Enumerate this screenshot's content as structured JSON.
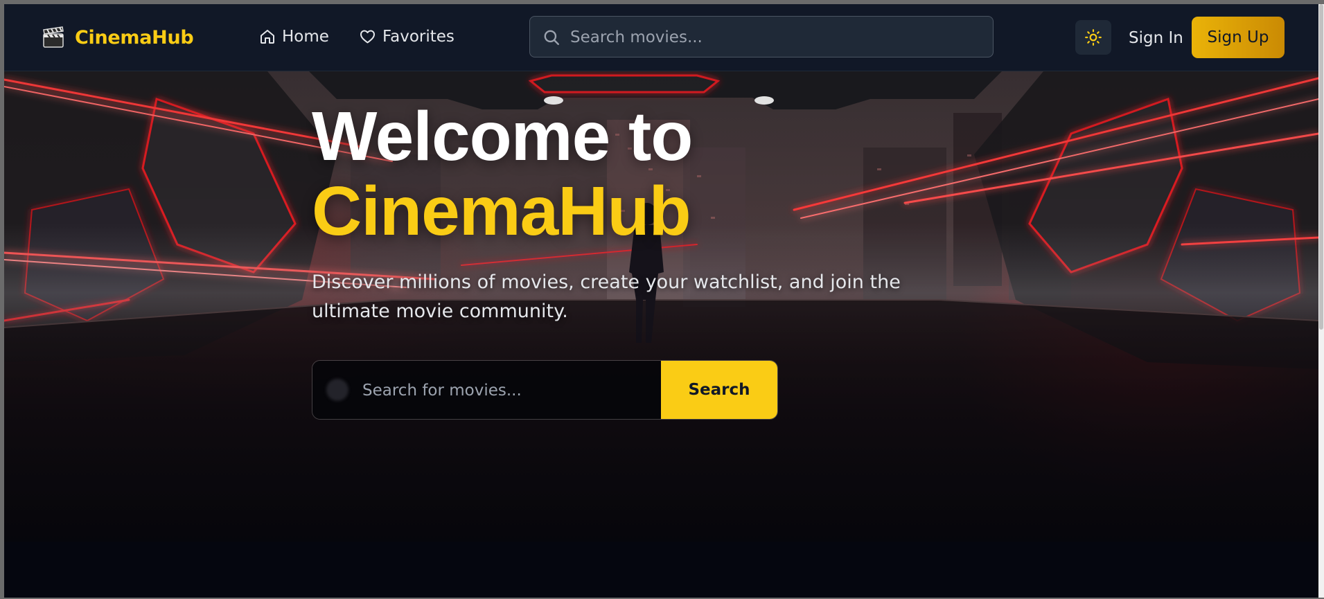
{
  "app": {
    "brand_name": "CinemaHub",
    "brand_icon": "clapperboard-icon",
    "accent_color": "#facc15"
  },
  "nav": {
    "home_label": "Home",
    "home_icon": "home-icon",
    "favorites_label": "Favorites",
    "favorites_icon": "heart-icon",
    "search_placeholder": "Search movies...",
    "search_icon": "search-icon",
    "theme_icon": "sun-icon",
    "sign_in_label": "Sign In",
    "sign_up_label": "Sign Up"
  },
  "hero": {
    "title_line1": "Welcome to",
    "title_line2": "CinemaHub",
    "subtitle": "Discover millions of movies, create your watchlist, and join the ultimate movie community.",
    "search_placeholder": "Search for movies...",
    "search_button_label": "Search"
  }
}
